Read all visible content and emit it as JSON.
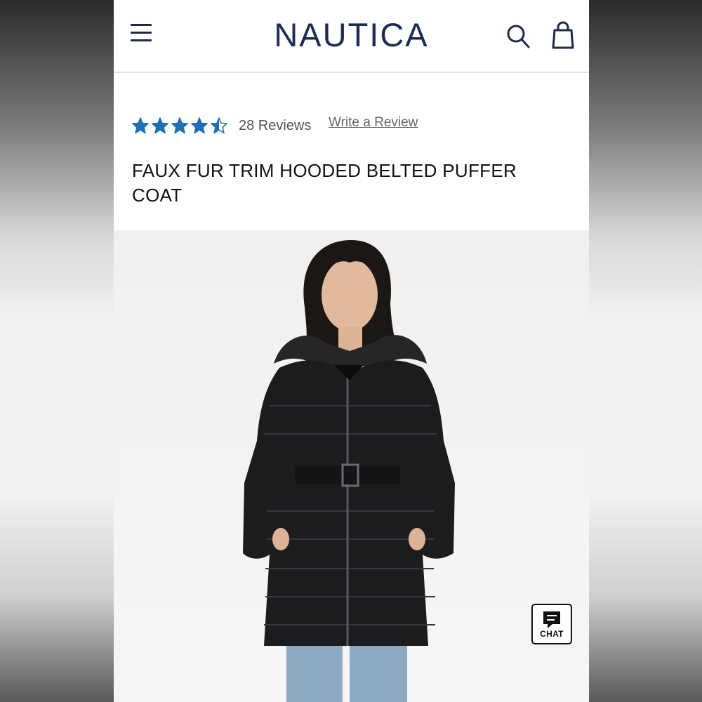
{
  "header": {
    "brand": "NAUTICA",
    "menu_icon": "hamburger-menu-icon",
    "search_icon": "search-icon",
    "bag_icon": "shopping-bag-icon",
    "brand_color": "#1b2d55"
  },
  "product": {
    "rating": 4.5,
    "rating_max": 5,
    "star_color": "#1f6fb4",
    "reviews_label": "28 Reviews",
    "write_review_label": "Write a Review",
    "title": "FAUX FUR TRIM HOODED BELTED PUFFER COAT"
  },
  "chat": {
    "label": "CHAT",
    "icon": "chat-bubble-icon"
  }
}
